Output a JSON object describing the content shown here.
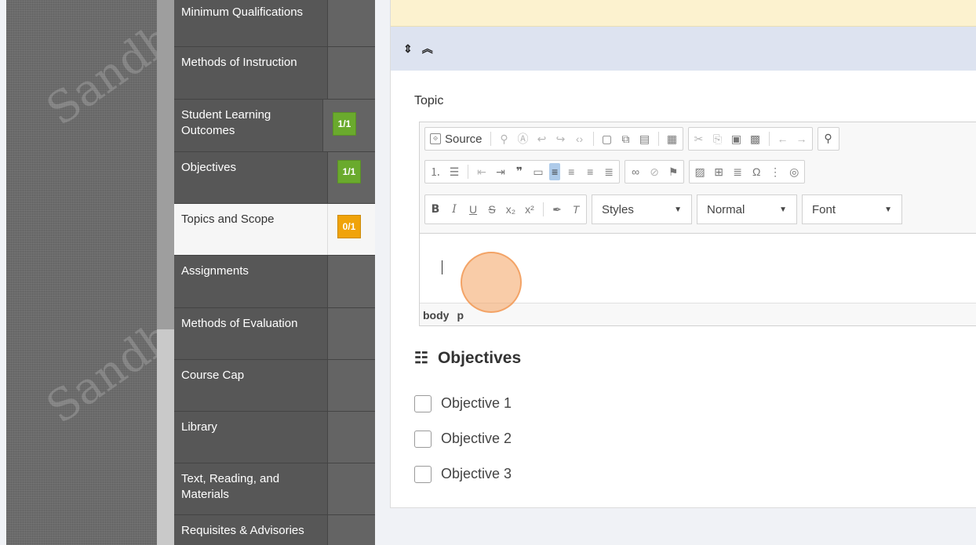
{
  "watermark": "Sandbox",
  "nav": [
    {
      "label": "Minimum Qualifications",
      "badge": null
    },
    {
      "label": "Methods of Instruction",
      "badge": null
    },
    {
      "label": "Student Learning Outcomes",
      "badge": "1/1",
      "badge_color": "#6aaa2d"
    },
    {
      "label": "Objectives",
      "badge": "1/1",
      "badge_color": "#6aaa2d"
    },
    {
      "label": "Topics and Scope",
      "badge": "0/1",
      "badge_color": "#f0a30a",
      "active": true
    },
    {
      "label": "Assignments",
      "badge": null
    },
    {
      "label": "Methods of Evaluation",
      "badge": null
    },
    {
      "label": "Course Cap",
      "badge": null
    },
    {
      "label": "Library",
      "badge": null
    },
    {
      "label": "Text, Reading, and Materials",
      "badge": null
    },
    {
      "label": "Requisites & Advisories",
      "badge": null
    }
  ],
  "section": {
    "icons": [
      "sort-icon",
      "collapse-up-icon"
    ],
    "sort_glyph": "⇕",
    "collapse_glyph": "︽"
  },
  "topic": {
    "label": "Topic",
    "editor": {
      "source_label": "Source",
      "styles_label": "Styles",
      "format_label": "Normal",
      "font_label": "Font",
      "path": [
        "body",
        "p"
      ]
    }
  },
  "objectives": {
    "title": "Objectives",
    "items": [
      "Objective 1",
      "Objective 2",
      "Objective 3"
    ]
  },
  "colors": {
    "accent_green": "#6aaa2d",
    "accent_orange": "#f0a30a",
    "section_header": "#dde3f0",
    "notice": "#fcf2cf"
  }
}
